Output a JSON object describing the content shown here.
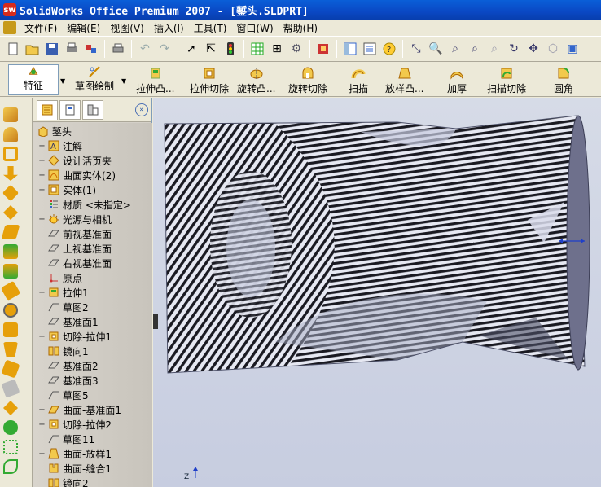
{
  "window": {
    "title": "SolidWorks Office Premium 2007 - [錾头.SLDPRT]",
    "app_icon": "sw"
  },
  "menu": {
    "items": [
      "文件(F)",
      "编辑(E)",
      "视图(V)",
      "插入(I)",
      "工具(T)",
      "窗口(W)",
      "帮助(H)"
    ]
  },
  "toolbar": {
    "icons": [
      "new-icon",
      "open-icon",
      "save-icon",
      "print-icon",
      "undo-icon",
      "redo-icon",
      "select-icon",
      "rebuild-icon",
      "options-icon"
    ]
  },
  "command_manager": {
    "tabs": [
      "特征",
      "草图绘制"
    ],
    "buttons": [
      "拉伸凸...",
      "拉伸切除",
      "旋转凸...",
      "旋转切除",
      "扫描",
      "放样凸...",
      "加厚",
      "扫描切除",
      "圆角"
    ]
  },
  "tree": {
    "root": "錾头",
    "items": [
      {
        "label": "注解",
        "expand": true
      },
      {
        "label": "设计活页夹",
        "expand": true
      },
      {
        "label": "曲面实体(2)",
        "expand": true
      },
      {
        "label": "实体(1)",
        "expand": true
      },
      {
        "label": "材质 <未指定>",
        "expand": false
      },
      {
        "label": "光源与相机",
        "expand": true
      },
      {
        "label": "前视基准面",
        "expand": false
      },
      {
        "label": "上视基准面",
        "expand": false
      },
      {
        "label": "右视基准面",
        "expand": false
      },
      {
        "label": "原点",
        "expand": false
      },
      {
        "label": "拉伸1",
        "expand": true
      },
      {
        "label": "草图2",
        "expand": false
      },
      {
        "label": "基准面1",
        "expand": false
      },
      {
        "label": "切除-拉伸1",
        "expand": true
      },
      {
        "label": "镜向1",
        "expand": false
      },
      {
        "label": "基准面2",
        "expand": false
      },
      {
        "label": "基准面3",
        "expand": false
      },
      {
        "label": "草图5",
        "expand": false
      },
      {
        "label": "曲面-基准面1",
        "expand": true
      },
      {
        "label": "切除-拉伸2",
        "expand": true
      },
      {
        "label": "草图11",
        "expand": false
      },
      {
        "label": "曲面-放样1",
        "expand": true
      },
      {
        "label": "曲面-缝合1",
        "expand": false
      },
      {
        "label": "镜向2",
        "expand": false
      }
    ]
  },
  "viewport": {
    "axis_label": "Z"
  },
  "colors": {
    "title_bar": "#0a48c4",
    "tree_bg": "#d4d0c8",
    "viewport_bg": "#cfd4e3"
  }
}
